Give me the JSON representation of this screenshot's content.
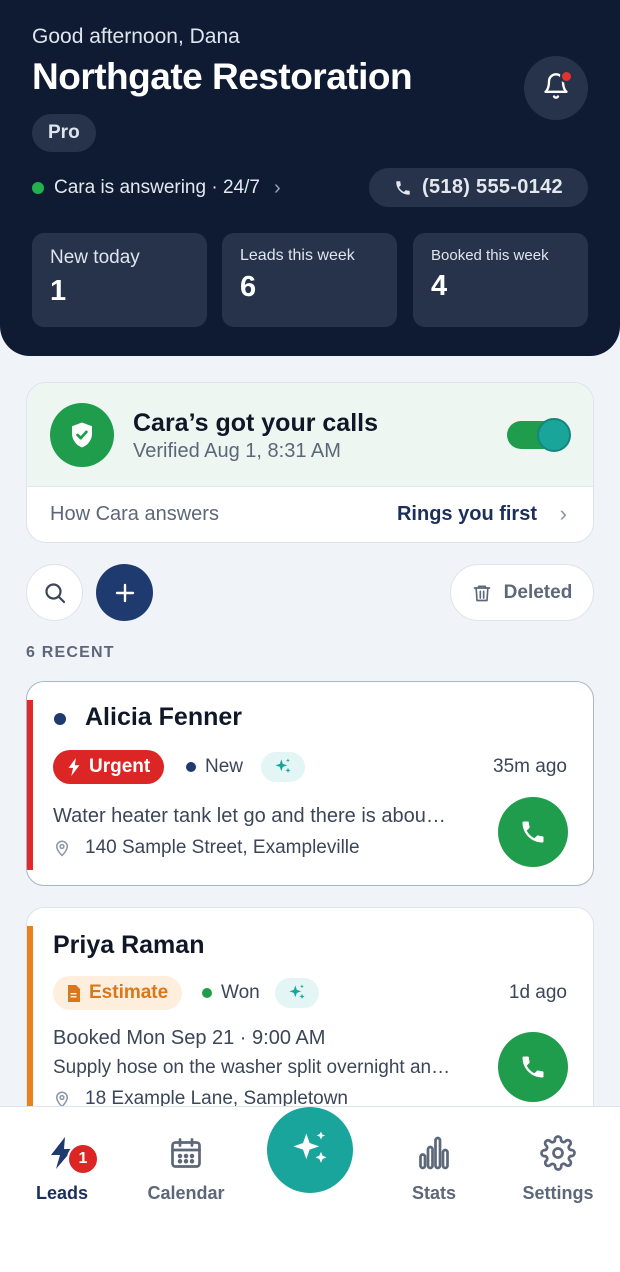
{
  "header": {
    "greeting": "Good afternoon, Dana",
    "business_name": "Northgate Restoration",
    "plan": "Pro",
    "status_text": "Cara is answering · 24/7",
    "phone": "(518) 555-0142",
    "stats": [
      {
        "label": "New today",
        "value": "1"
      },
      {
        "label": "Leads this week",
        "value": "6"
      },
      {
        "label": "Booked this week",
        "value": "4"
      }
    ]
  },
  "cara_card": {
    "title": "Cara’s got your calls",
    "subtitle": "Verified Aug 1, 8:31 AM",
    "toggle_on": true,
    "how_label": "How Cara answers",
    "how_value": "Rings you first"
  },
  "tools": {
    "deleted_label": "Deleted"
  },
  "recent_label": "6 RECENT",
  "leads": [
    {
      "name": "Alicia Fenner",
      "tag": "Urgent",
      "stage": "New",
      "time_ago": "35m ago",
      "summary": "Water heater tank let go and there is abou…",
      "address": "140 Sample Street, Exampleville"
    },
    {
      "name": "Priya Raman",
      "tag": "Estimate",
      "stage": "Won",
      "time_ago": "1d ago",
      "booked": "Booked Mon Sep 21 · 9:00 AM",
      "summary": "Supply hose on the washer split overnight an…",
      "address": "18 Example Lane, Sampletown"
    }
  ],
  "nav": {
    "leads": "Leads",
    "leads_badge": "1",
    "calendar": "Calendar",
    "stats": "Stats",
    "settings": "Settings"
  },
  "colors": {
    "header_bg": "#0f1b33",
    "accent_green": "#1f9d4c",
    "accent_teal": "#19a59b",
    "urgent_red": "#dc2626",
    "estimate_orange": "#e8821c",
    "navy": "#1f3a6e"
  }
}
